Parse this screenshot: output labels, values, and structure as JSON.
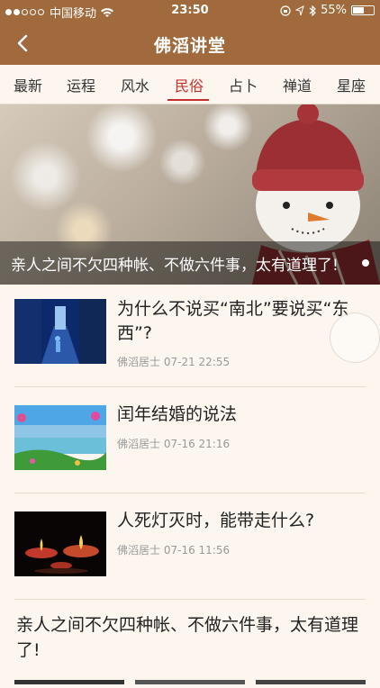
{
  "status": {
    "carrier": "中国移动",
    "time": "23:50",
    "battery": "55%"
  },
  "nav": {
    "title": "佛滔讲堂"
  },
  "tabs": [
    {
      "label": "最新"
    },
    {
      "label": "运程"
    },
    {
      "label": "风水"
    },
    {
      "label": "民俗"
    },
    {
      "label": "占卜"
    },
    {
      "label": "禅道"
    },
    {
      "label": "星座"
    }
  ],
  "active_tab": "民俗",
  "banner": {
    "caption": "亲人之间不欠四种帐、不做六件事，太有道理了!"
  },
  "articles": [
    {
      "title": "为什么不说买“南北”要说买“东西”?",
      "author": "佛滔居士",
      "date": "07-21 22:55"
    },
    {
      "title": "闰年结婚的说法",
      "author": "佛滔居士",
      "date": "07-16 21:16"
    },
    {
      "title": "人死灯灭时，能带走什么?",
      "author": "佛滔居士",
      "date": "07-16 11:56"
    }
  ],
  "featured": {
    "title": "亲人之间不欠四种帐、不做六件事，太有道理了!"
  },
  "colors": {
    "nav_bg": "#a06a3c",
    "accent": "#c6302c",
    "page_bg": "#fcf6ee"
  }
}
